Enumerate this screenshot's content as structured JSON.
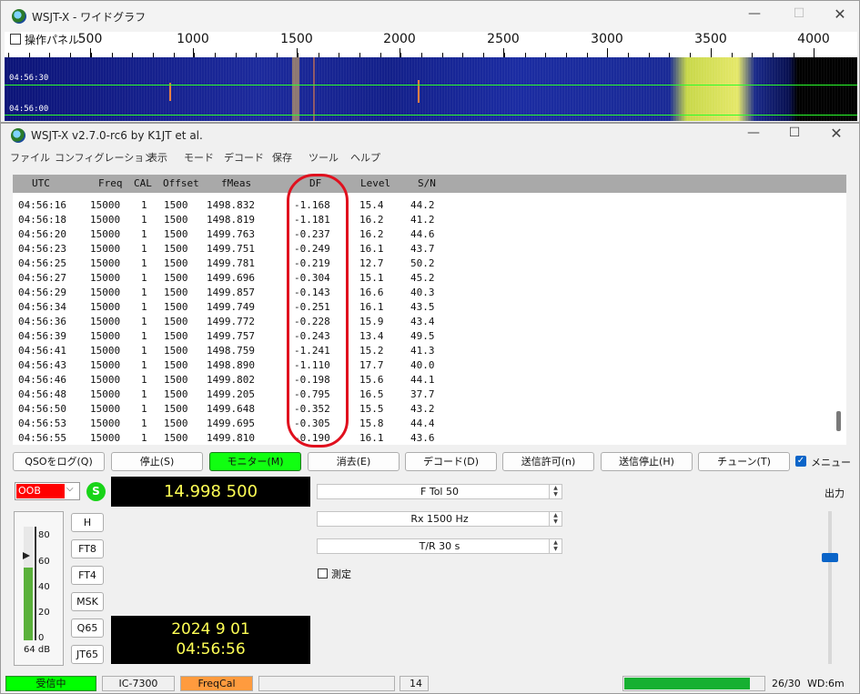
{
  "wide_graph": {
    "title": "WSJT-X - ワイドグラフ",
    "panel_checkbox_label": "操作パネル",
    "freq_ticks": [
      "500",
      "1000",
      "1500",
      "2000",
      "2500",
      "3000",
      "3500",
      "4000"
    ],
    "time_labels": [
      "04:56:30",
      "04:56:00"
    ]
  },
  "main_window": {
    "title": "WSJT-X   v2.7.0-rc6   by K1JT et al.",
    "menu": [
      "ファイル",
      "コンフィグレーション",
      "表示",
      "モード",
      "デコード",
      "保存",
      "ツール",
      "ヘルプ"
    ]
  },
  "table": {
    "headers": [
      "UTC",
      "Freq",
      "CAL",
      "Offset",
      "fMeas",
      "DF",
      "Level",
      "S/N"
    ],
    "rows": [
      [
        "04:56:16",
        "15000",
        "1",
        "1500",
        "1498.832",
        "-1.168",
        "15.4",
        "44.2"
      ],
      [
        "04:56:18",
        "15000",
        "1",
        "1500",
        "1498.819",
        "-1.181",
        "16.2",
        "41.2"
      ],
      [
        "04:56:20",
        "15000",
        "1",
        "1500",
        "1499.763",
        "-0.237",
        "16.2",
        "44.6"
      ],
      [
        "04:56:23",
        "15000",
        "1",
        "1500",
        "1499.751",
        "-0.249",
        "16.1",
        "43.7"
      ],
      [
        "04:56:25",
        "15000",
        "1",
        "1500",
        "1499.781",
        "-0.219",
        "12.7",
        "50.2"
      ],
      [
        "04:56:27",
        "15000",
        "1",
        "1500",
        "1499.696",
        "-0.304",
        "15.1",
        "45.2"
      ],
      [
        "04:56:29",
        "15000",
        "1",
        "1500",
        "1499.857",
        "-0.143",
        "16.6",
        "40.3"
      ],
      [
        "04:56:34",
        "15000",
        "1",
        "1500",
        "1499.749",
        "-0.251",
        "16.1",
        "43.5"
      ],
      [
        "04:56:36",
        "15000",
        "1",
        "1500",
        "1499.772",
        "-0.228",
        "15.9",
        "43.4"
      ],
      [
        "04:56:39",
        "15000",
        "1",
        "1500",
        "1499.757",
        "-0.243",
        "13.4",
        "49.5"
      ],
      [
        "04:56:41",
        "15000",
        "1",
        "1500",
        "1498.759",
        "-1.241",
        "15.2",
        "41.3"
      ],
      [
        "04:56:43",
        "15000",
        "1",
        "1500",
        "1498.890",
        "-1.110",
        "17.7",
        "40.0"
      ],
      [
        "04:56:46",
        "15000",
        "1",
        "1500",
        "1499.802",
        "-0.198",
        "15.6",
        "44.1"
      ],
      [
        "04:56:48",
        "15000",
        "1",
        "1500",
        "1499.205",
        "-0.795",
        "16.5",
        "37.7"
      ],
      [
        "04:56:50",
        "15000",
        "1",
        "1500",
        "1499.648",
        "-0.352",
        "15.5",
        "43.2"
      ],
      [
        "04:56:53",
        "15000",
        "1",
        "1500",
        "1499.695",
        "-0.305",
        "15.8",
        "44.4"
      ],
      [
        "04:56:55",
        "15000",
        "1",
        "1500",
        "1499.810",
        "-0.190",
        "16.1",
        "43.6"
      ]
    ]
  },
  "buttons": {
    "log_qso": "QSOをログ(Q)",
    "stop": "停止(S)",
    "monitor": "モニター(M)",
    "erase": "消去(E)",
    "decode": "デコード(D)",
    "enable_tx": "送信許可(n)",
    "halt_tx": "送信停止(H)",
    "tune": "チューン(T)",
    "menus_label": "メニュー"
  },
  "controls": {
    "band_value": "OOB",
    "s_button": "S",
    "dial_frequency": "14.998 500",
    "mode_buttons": [
      "H",
      "FT8",
      "FT4",
      "MSK",
      "Q65",
      "JT65"
    ],
    "meter_ticks": [
      "80",
      "60",
      "40",
      "20",
      "0"
    ],
    "meter_level": 0.64,
    "meter_db": "64 dB",
    "date": "2024 9 01",
    "time": "04:56:56",
    "ftol": "F Tol  50",
    "rx": "Rx  1500  Hz",
    "tr": "T/R  30  s",
    "measure_label": "測定",
    "output_label": "出力"
  },
  "status": {
    "receiving": "受信中",
    "rig": "IC-7300",
    "mode": "FreqCal",
    "value": "14",
    "progress_fraction": 0.9,
    "count": "26/30",
    "wd": "WD:6m"
  },
  "colors": {
    "highlight_ellipse": "#e0101e",
    "monitor_green": "#11ff11",
    "band_red": "#ff0000",
    "freqcal_orange": "#ff9b3e",
    "status_green": "#00ff00"
  }
}
